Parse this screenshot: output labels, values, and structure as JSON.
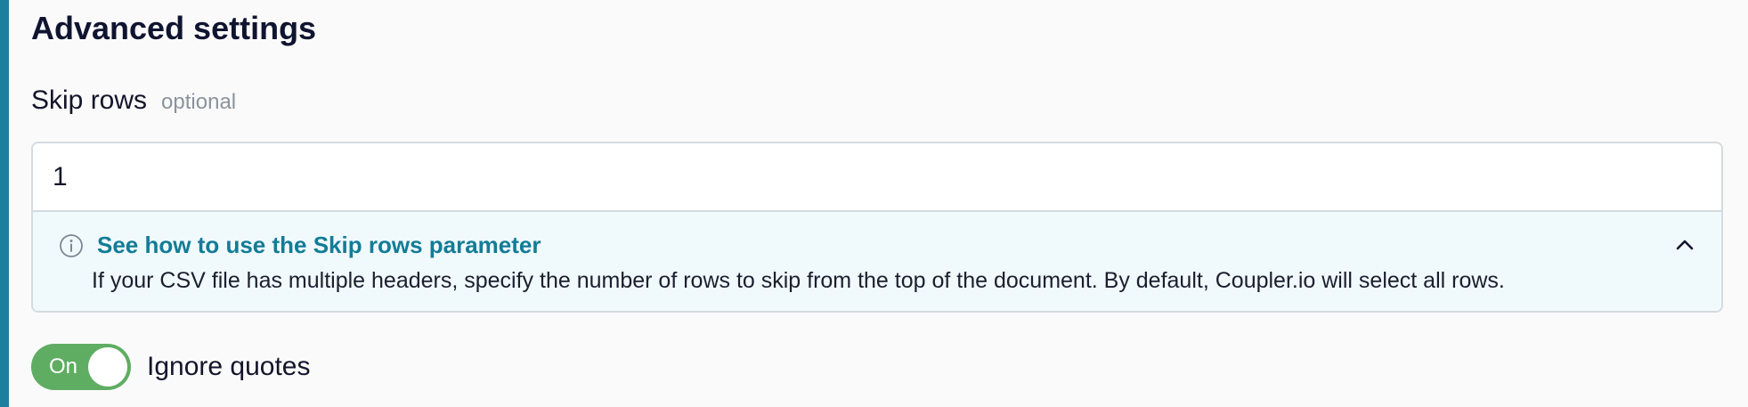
{
  "section": {
    "title": "Advanced settings"
  },
  "skip_rows": {
    "label": "Skip rows",
    "optional_text": "optional",
    "value": "1",
    "hint": {
      "icon": "info-icon",
      "link_text": "See how to use the Skip rows parameter",
      "description": "If your CSV file has multiple headers, specify the number of rows to skip from the top of the document. By default, Coupler.io will select all rows.",
      "collapse_icon": "chevron-up-icon"
    }
  },
  "ignore_quotes": {
    "toggle_state": "On",
    "label": "Ignore quotes"
  },
  "colors": {
    "accent_bar": "#1d7f9e",
    "link": "#137c96",
    "toggle_on": "#5fad63",
    "hint_background": "#f0f9fc"
  }
}
